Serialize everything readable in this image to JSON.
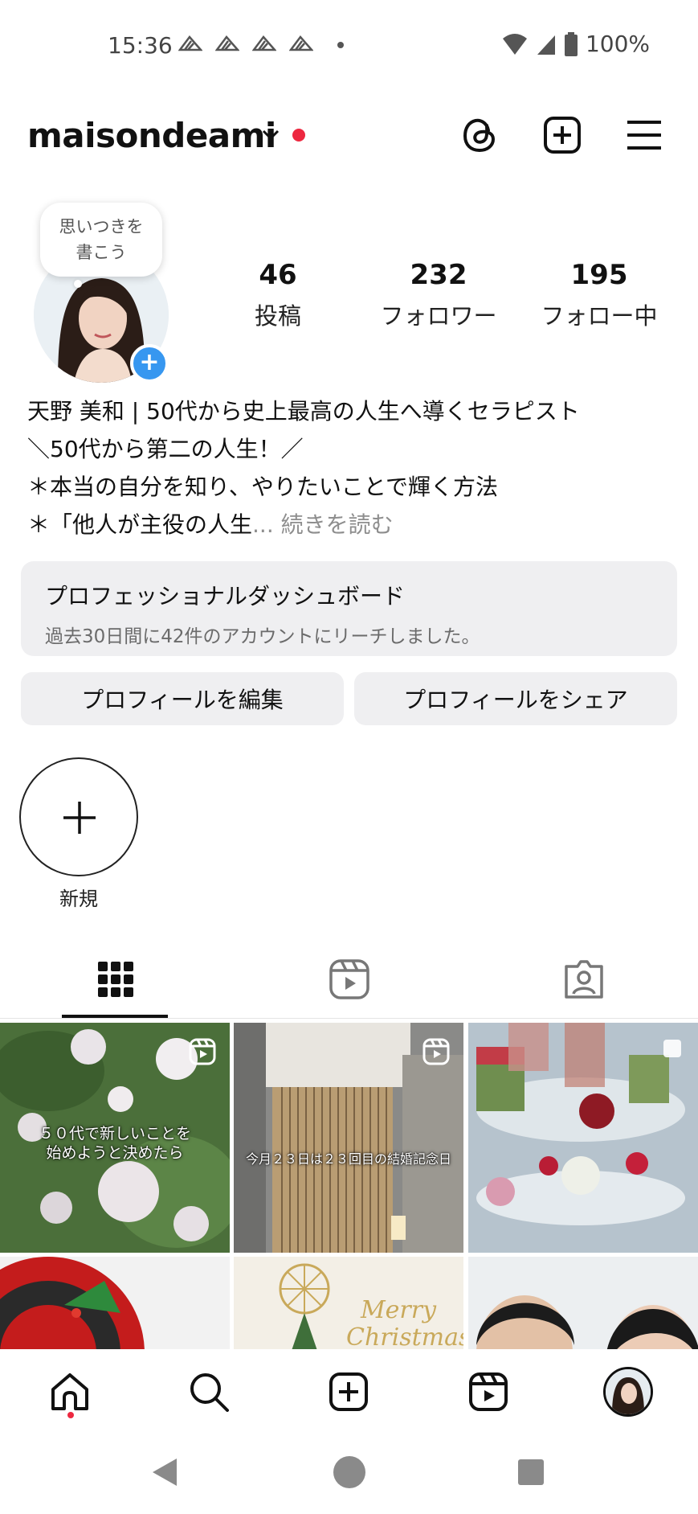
{
  "status_bar": {
    "time": "15:36",
    "battery": "100%"
  },
  "header": {
    "username": "maisondeami",
    "icons": [
      "threads-icon",
      "create-plus-icon",
      "menu-hamburger-icon"
    ]
  },
  "profile": {
    "note_placeholder_line1": "思いつきを",
    "note_placeholder_line2": "書こう",
    "stats": [
      {
        "count": "46",
        "label": "投稿"
      },
      {
        "count": "232",
        "label": "フォロワー"
      },
      {
        "count": "195",
        "label": "フォロー中"
      }
    ],
    "bio_lines": [
      "天野 美和 | 50代から史上最高の人生へ導くセラピスト",
      "＼50代から第二の人生！／",
      "＊本当の自分を知り、やりたいことで輝く方法",
      "＊「他人が主役の人生"
    ],
    "bio_more": "... 続きを読む"
  },
  "dashboard": {
    "title": "プロフェッショナルダッシュボード",
    "subtitle": "過去30日間に42件のアカウントにリーチしました。"
  },
  "buttons": {
    "edit_profile": "プロフィールを編集",
    "share_profile": "プロフィールをシェア"
  },
  "highlights": {
    "new_label": "新規"
  },
  "tabs": [
    "grid-icon",
    "reels-icon",
    "tagged-icon"
  ],
  "grid_posts": [
    {
      "caption_line1": "５０代で新しいことを",
      "caption_line2": "始めようと決めたら"
    },
    {
      "caption_line1": "今月２３日は２３回目の結婚記念日"
    },
    {
      "caption_line1": ""
    },
    {
      "caption_line1": ""
    },
    {
      "caption_line1": "Merry",
      "caption_line2": "Christmas"
    },
    {
      "caption_line1": ""
    }
  ],
  "bottom_nav": [
    "home-icon",
    "search-icon",
    "create-icon",
    "reels-icon",
    "profile-avatar"
  ],
  "colors": {
    "accent_blue": "#3797f0",
    "notification_red": "#ed2840",
    "button_gray": "#efeff1"
  }
}
